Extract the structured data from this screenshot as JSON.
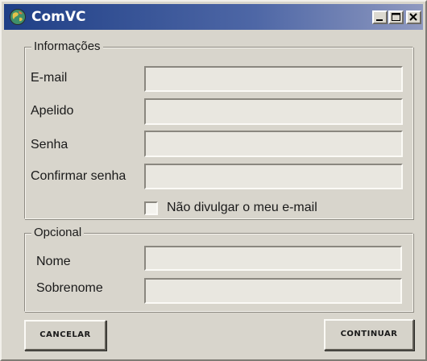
{
  "window": {
    "title": "ComVC"
  },
  "info_group": {
    "legend": "Informações",
    "email_label": "E-mail",
    "email_value": "",
    "nickname_label": "Apelido",
    "nickname_value": "",
    "password_label": "Senha",
    "password_value": "",
    "confirm_label": "Confirmar senha",
    "confirm_value": "",
    "hide_email_label": "Não divulgar  o meu e-mail",
    "hide_email_checked": false
  },
  "optional_group": {
    "legend": "Opcional",
    "name_label": "Nome",
    "name_value": "",
    "surname_label": "Sobrenome",
    "surname_value": ""
  },
  "buttons": {
    "cancel_label": "CANCELAR",
    "continue_label": "CONTINUAR"
  },
  "icons": {
    "app": "globe-icon",
    "minimize": "minimize-icon",
    "maximize": "maximize-icon",
    "close": "close-icon"
  }
}
